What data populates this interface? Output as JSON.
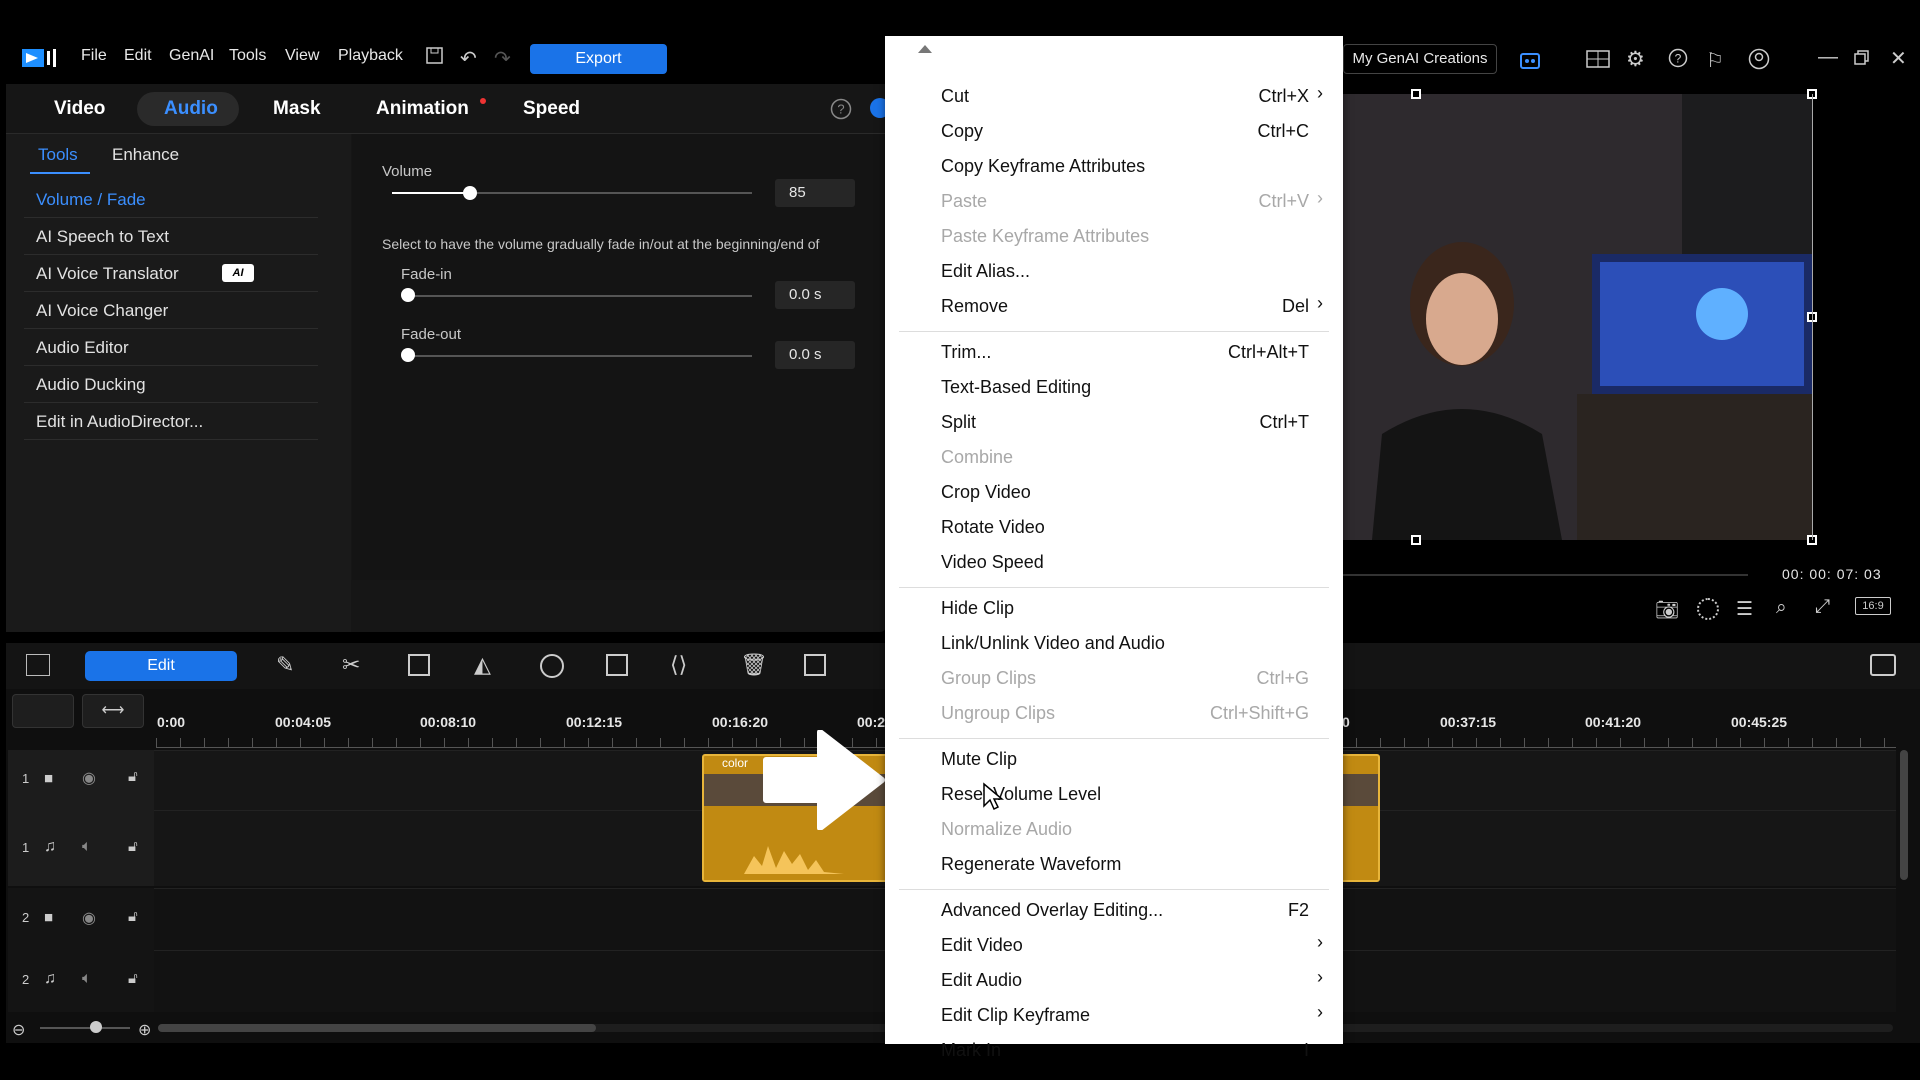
{
  "app": {
    "menus": [
      "File",
      "Edit",
      "GenAI",
      "Tools",
      "View",
      "Playback"
    ],
    "export_label": "Export",
    "genai_label": "My GenAI Creations"
  },
  "panel": {
    "tabs": [
      "Video",
      "Audio",
      "Mask",
      "Animation",
      "Speed"
    ],
    "subtabs": [
      "Tools",
      "Enhance"
    ],
    "tools": [
      "Volume / Fade",
      "AI Speech to Text",
      "AI Voice Translator",
      "AI Voice Changer",
      "Audio Editor",
      "Audio Ducking",
      "Edit in AudioDirector..."
    ],
    "ai_badge": "AI",
    "volume_label": "Volume",
    "volume_value": "85",
    "volume_level": 0.85,
    "fade_desc": "Select to have the volume gradually fade in/out at the beginning/end of",
    "fadein_label": "Fade-in",
    "fadein_value": "0.0 s",
    "fadeout_label": "Fade-out",
    "fadeout_value": "0.0 s"
  },
  "preview": {
    "timecode": "00: 00: 07: 03",
    "ratio": "16:9"
  },
  "context_menu": {
    "items": [
      {
        "label": "Cut",
        "shortcut": "Ctrl+X",
        "arrow": true,
        "disabled": false
      },
      {
        "label": "Copy",
        "shortcut": "Ctrl+C",
        "arrow": false,
        "disabled": false
      },
      {
        "label": "Copy Keyframe Attributes",
        "shortcut": "",
        "arrow": false,
        "disabled": false
      },
      {
        "label": "Paste",
        "shortcut": "Ctrl+V",
        "arrow": true,
        "disabled": true
      },
      {
        "label": "Paste Keyframe Attributes",
        "shortcut": "",
        "arrow": false,
        "disabled": true
      },
      {
        "label": "Edit Alias...",
        "shortcut": "",
        "arrow": false,
        "disabled": false
      },
      {
        "label": "Remove",
        "shortcut": "Del",
        "arrow": true,
        "disabled": false
      },
      {
        "sep": true
      },
      {
        "label": "Trim...",
        "shortcut": "Ctrl+Alt+T",
        "arrow": false,
        "disabled": false
      },
      {
        "label": "Text-Based Editing",
        "shortcut": "",
        "arrow": false,
        "disabled": false
      },
      {
        "label": "Split",
        "shortcut": "Ctrl+T",
        "arrow": false,
        "disabled": false
      },
      {
        "label": "Combine",
        "shortcut": "",
        "arrow": false,
        "disabled": true
      },
      {
        "label": "Crop Video",
        "shortcut": "",
        "arrow": false,
        "disabled": false
      },
      {
        "label": "Rotate Video",
        "shortcut": "",
        "arrow": false,
        "disabled": false
      },
      {
        "label": "Video Speed",
        "shortcut": "",
        "arrow": false,
        "disabled": false
      },
      {
        "sep": true
      },
      {
        "label": "Hide Clip",
        "shortcut": "",
        "arrow": false,
        "disabled": false
      },
      {
        "label": "Link/Unlink Video and Audio",
        "shortcut": "",
        "arrow": false,
        "disabled": false
      },
      {
        "label": "Group Clips",
        "shortcut": "Ctrl+G",
        "arrow": false,
        "disabled": true
      },
      {
        "label": "Ungroup Clips",
        "shortcut": "Ctrl+Shift+G",
        "arrow": false,
        "disabled": true
      },
      {
        "sep": true
      },
      {
        "label": "Mute Clip",
        "shortcut": "",
        "arrow": false,
        "disabled": false
      },
      {
        "label": "Reset Volume Level",
        "shortcut": "",
        "arrow": false,
        "disabled": false
      },
      {
        "label": "Normalize Audio",
        "shortcut": "",
        "arrow": false,
        "disabled": true
      },
      {
        "label": "Regenerate Waveform",
        "shortcut": "",
        "arrow": false,
        "disabled": false
      },
      {
        "sep": true
      },
      {
        "label": "Advanced Overlay Editing...",
        "shortcut": "F2",
        "arrow": false,
        "disabled": false
      },
      {
        "label": "Edit Video",
        "shortcut": "",
        "arrow": true,
        "disabled": false
      },
      {
        "label": "Edit Audio",
        "shortcut": "",
        "arrow": true,
        "disabled": false
      },
      {
        "label": "Edit Clip Keyframe",
        "shortcut": "",
        "arrow": true,
        "disabled": false
      },
      {
        "label": "Mark In",
        "shortcut": "I",
        "arrow": false,
        "disabled": false
      }
    ]
  },
  "timeline": {
    "edit_label": "Edit",
    "ticks": [
      "0:00",
      "00:04:05",
      "00:08:10",
      "00:12:15",
      "00:16:20",
      "00:2",
      "0",
      "00:37:15",
      "00:41:20",
      "00:45:25"
    ],
    "tracks": [
      "1",
      "1",
      "2",
      "2"
    ],
    "clip_label": "color"
  }
}
